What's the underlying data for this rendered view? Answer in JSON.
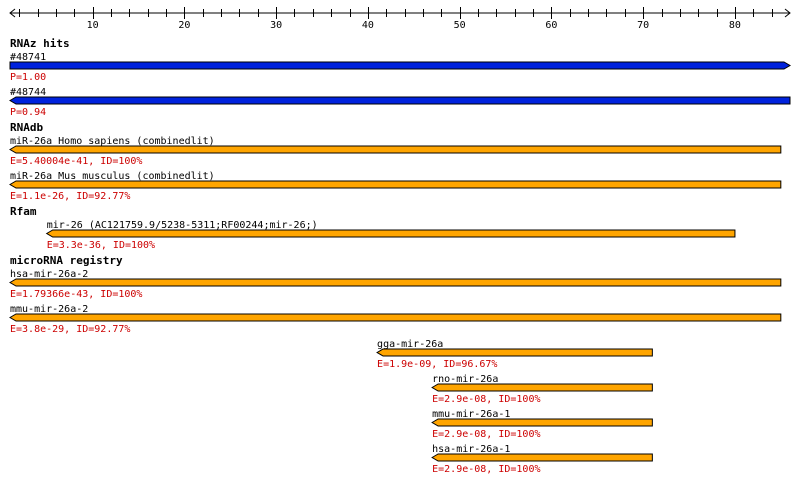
{
  "ruler": {
    "min": 1,
    "max": 86,
    "major_ticks": [
      10,
      20,
      30,
      40,
      50,
      60,
      70,
      80
    ],
    "minor_step": 2,
    "labels": [
      "10",
      "20",
      "30",
      "40",
      "50",
      "60",
      "70",
      "80"
    ]
  },
  "colors": {
    "rnaz": "#0022dd",
    "hit": "#ffa500",
    "score_text": "#cc0000",
    "outline": "#000000"
  },
  "tracks": [
    {
      "title": "RNAz hits",
      "color": "rnaz",
      "features": [
        {
          "label": "#48741",
          "score": "P=1.00",
          "start": 1,
          "end": 86,
          "strand": "+"
        },
        {
          "label": "#48744",
          "score": "P=0.94",
          "start": 1,
          "end": 86,
          "strand": "-"
        }
      ]
    },
    {
      "title": "RNAdb",
      "color": "hit",
      "features": [
        {
          "label": "miR-26a Homo sapiens (combinedlit)",
          "score": "E=5.40004e-41, ID=100%",
          "start": 1,
          "end": 85,
          "strand": "-"
        },
        {
          "label": "miR-26a Mus musculus (combinedlit)",
          "score": "E=1.1e-26, ID=92.77%",
          "start": 1,
          "end": 85,
          "strand": "-"
        }
      ]
    },
    {
      "title": "Rfam",
      "color": "hit",
      "features": [
        {
          "label": "mir-26 (AC121759.9/5238-5311;RF00244;mir-26;)",
          "score": "E=3.3e-36, ID=100%",
          "start": 5,
          "end": 80,
          "strand": "-"
        }
      ]
    },
    {
      "title": "microRNA registry",
      "color": "hit",
      "features": [
        {
          "label": "hsa-mir-26a-2",
          "score": "E=1.79366e-43, ID=100%",
          "start": 1,
          "end": 85,
          "strand": "-"
        },
        {
          "label": "mmu-mir-26a-2",
          "score": "E=3.8e-29, ID=92.77%",
          "start": 1,
          "end": 85,
          "strand": "-"
        },
        {
          "label": "gga-mir-26a",
          "score": "E=1.9e-09, ID=96.67%",
          "start": 41,
          "end": 71,
          "strand": "-"
        },
        {
          "label": "rno-mir-26a",
          "score": "E=2.9e-08, ID=100%",
          "start": 47,
          "end": 71,
          "strand": "-"
        },
        {
          "label": "mmu-mir-26a-1",
          "score": "E=2.9e-08, ID=100%",
          "start": 47,
          "end": 71,
          "strand": "-"
        },
        {
          "label": "hsa-mir-26a-1",
          "score": "E=2.9e-08, ID=100%",
          "start": 47,
          "end": 71,
          "strand": "-"
        }
      ]
    }
  ]
}
